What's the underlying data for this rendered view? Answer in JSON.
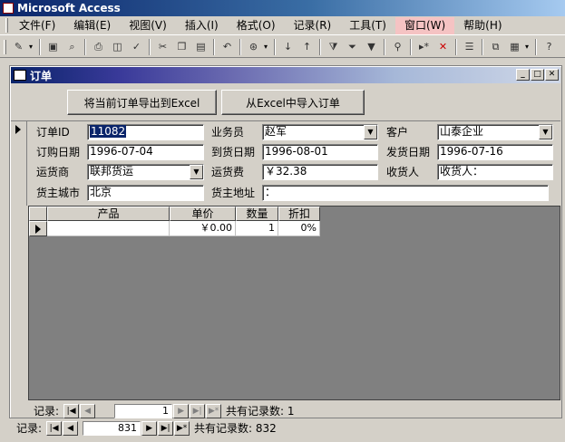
{
  "app": {
    "title": "Microsoft Access"
  },
  "menu": [
    "文件(F)",
    "编辑(E)",
    "视图(V)",
    "插入(I)",
    "格式(O)",
    "记录(R)",
    "工具(T)",
    "窗口(W)",
    "帮助(H)"
  ],
  "toolbar": {
    "icons": [
      "design-view-icon",
      "save-icon",
      "find-icon",
      "print-icon",
      "print-preview-icon",
      "spelling-icon",
      "cut-icon",
      "copy-icon",
      "paste-icon",
      "undo-icon",
      "hyperlink-icon",
      "sort-ascending-icon",
      "sort-descending-icon",
      "filter-by-selection-icon",
      "filter-by-form-icon",
      "apply-filter-icon",
      "find-binoculars-icon",
      "new-record-icon",
      "delete-record-icon",
      "properties-icon",
      "database-window-icon",
      "new-object-icon",
      "help-icon"
    ]
  },
  "form": {
    "title": "订单",
    "buttons": {
      "export": "将当前订单导出到Excel",
      "import": "从Excel中导入订单"
    },
    "fields": {
      "order_id": {
        "label": "订单ID",
        "value": "11082"
      },
      "salesperson": {
        "label": "业务员",
        "value": "赵军"
      },
      "customer": {
        "label": "客户",
        "value": "山泰企业"
      },
      "order_date": {
        "label": "订购日期",
        "value": "1996-07-04"
      },
      "arrival_date": {
        "label": "到货日期",
        "value": "1996-08-01"
      },
      "ship_date": {
        "label": "发货日期",
        "value": "1996-07-16"
      },
      "shipper": {
        "label": "运货商",
        "value": "联邦货运"
      },
      "freight": {
        "label": "运货费",
        "value": "￥32.38"
      },
      "recipient": {
        "label": "收货人",
        "value": "收货人："
      },
      "ship_city": {
        "label": "货主城市",
        "value": "北京"
      },
      "ship_address": {
        "label": "货主地址",
        "value": "："
      }
    },
    "subform": {
      "headers": [
        "产品",
        "单价",
        "数量",
        "折扣"
      ],
      "row": [
        "",
        "￥0.00",
        "1",
        "0%"
      ],
      "nav": {
        "label": "记录:",
        "current": "1",
        "total": "共有记录数: 1"
      }
    },
    "nav": {
      "label": "记录:",
      "current": "831",
      "total": "共有记录数: 832"
    }
  }
}
